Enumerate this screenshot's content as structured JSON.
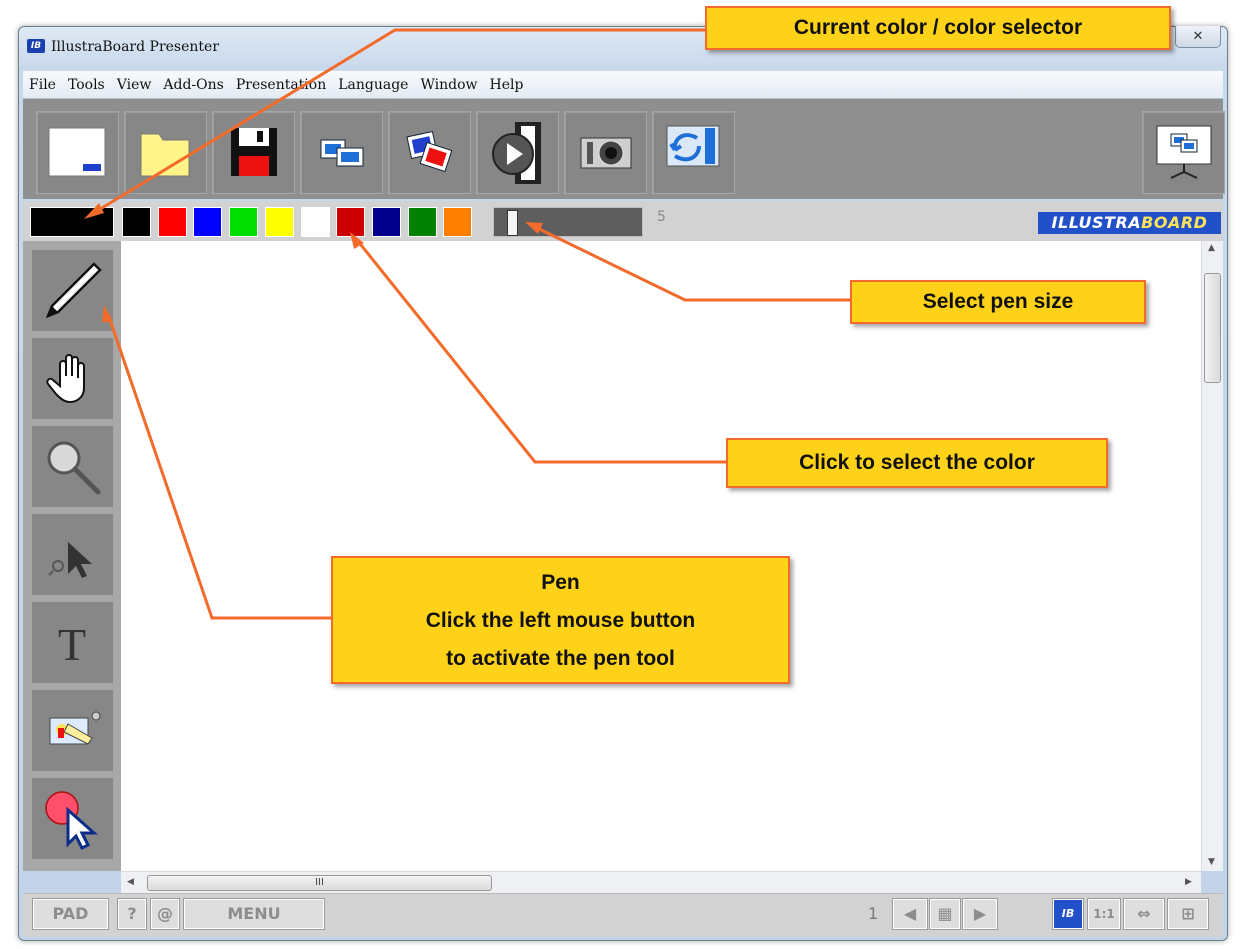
{
  "window": {
    "title": "IllustraBoard Presenter",
    "logo": "IB",
    "close_icon": "close-icon"
  },
  "menu": [
    "File",
    "Tools",
    "View",
    "Add-Ons",
    "Presentation",
    "Language",
    "Window",
    "Help"
  ],
  "toolbar": {
    "icons": [
      "new-board-icon",
      "open-folder-icon",
      "save-icon",
      "screen-capture-icon",
      "slides-icon",
      "play-presentation-icon",
      "camera-icon",
      "import-icon",
      "monitor-display-icon"
    ]
  },
  "colorbar": {
    "current_color": "#000000",
    "swatches": [
      "#000000",
      "#ff0000",
      "#0000ff",
      "#00dd00",
      "#ffff00",
      "#ffffff",
      "#cc0000",
      "#00008b",
      "#008000",
      "#ff8000"
    ],
    "pen_size": "5",
    "brand_part1": "ILLUSTRA",
    "brand_part2": "BOARD"
  },
  "side_tools": [
    "pen-icon",
    "hand-icon",
    "magnifier-icon",
    "select-icon",
    "text-icon",
    "stamp-icon",
    "pointer-icon"
  ],
  "side_text_glyph": "T",
  "scrollbar": {
    "hthumb_grip": "III"
  },
  "statusbar": {
    "pad": "PAD",
    "help": "?",
    "at": "@",
    "menu": "MENU",
    "page": "1",
    "ib": "IB",
    "ratio": "1:1"
  },
  "callouts": {
    "color_selector": "Current color / color selector",
    "pen_size": "Select pen size",
    "select_color": "Click to select the color",
    "pen_line1": "Pen",
    "pen_line2": "Click the left mouse button",
    "pen_line3": "to activate the pen tool"
  }
}
